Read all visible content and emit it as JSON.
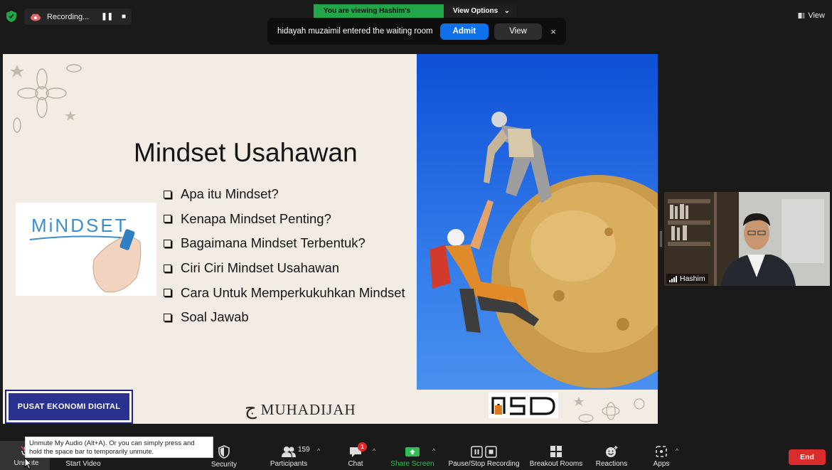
{
  "topbar": {
    "recording_label": "Recording...",
    "viewing_text": "You are viewing Hashim's screen",
    "view_options_label": "View Options",
    "view_label": "View"
  },
  "waiting_room": {
    "message": "hidayah muzaimil entered the waiting room",
    "admit_label": "Admit",
    "view_label": "View",
    "close_glyph": "×"
  },
  "slide": {
    "title": "Mindset Usahawan",
    "bullets": [
      "Apa itu Mindset?",
      "Kenapa Mindset Penting?",
      "Bagaimana Mindset Terbentuk?",
      "Ciri Ciri Mindset Usahawan",
      "Cara Untuk Memperkukuhkan Mindset",
      "Soal Jawab"
    ],
    "mindset_card_word": "MiNDSET",
    "pusat_logo": "PUSAT EKONOMI DIGITAL",
    "muhadijah_logo": "MUHADIJAH"
  },
  "participant": {
    "name": "Hashim"
  },
  "toolbar": {
    "unmute_label": "Unmute",
    "start_video_label": "Start Video",
    "security_label": "Security",
    "participants_label": "Participants",
    "participants_count": "159",
    "chat_label": "Chat",
    "chat_badge": "1",
    "share_screen_label": "Share Screen",
    "pause_recording_label": "Pause/Stop Recording",
    "breakout_label": "Breakout Rooms",
    "reactions_label": "Reactions",
    "apps_label": "Apps",
    "end_label": "End"
  },
  "tooltip": {
    "text": "Unmute My Audio (Alt+A). Or you can simply press and hold the space bar to temporarily unmute."
  },
  "colors": {
    "accent_blue": "#0e71eb",
    "viewing_green": "#23a64a",
    "end_red": "#d92d2d",
    "share_green": "#2fbf56"
  }
}
